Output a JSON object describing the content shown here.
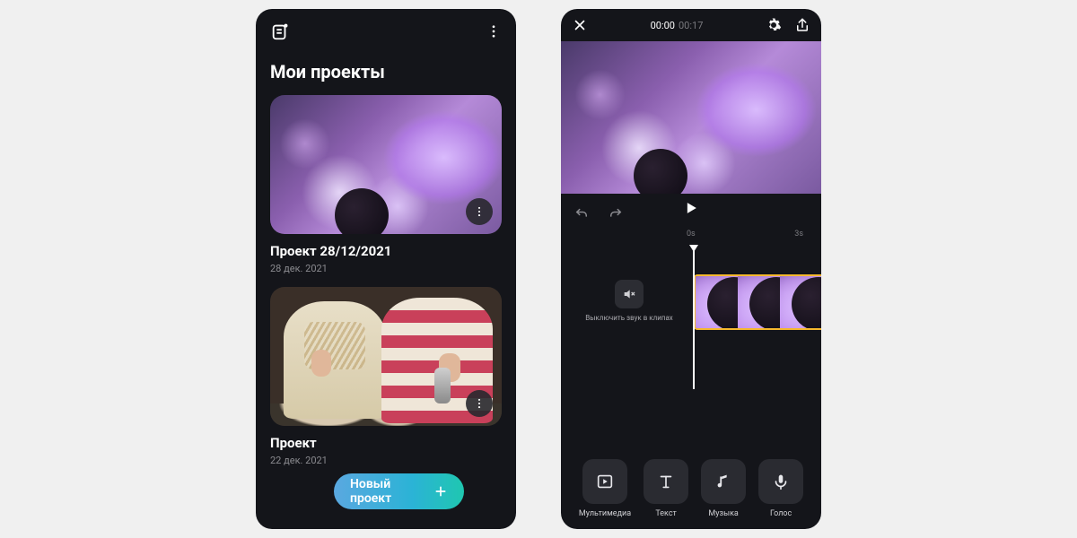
{
  "projects_screen": {
    "title": "Мои проекты",
    "items": [
      {
        "title": "Проект 28/12/2021",
        "date": "28 дек. 2021"
      },
      {
        "title": "Проект",
        "date": "22 дек. 2021"
      }
    ],
    "new_project_label": "Новый проект"
  },
  "editor_screen": {
    "time_current": "00:00",
    "time_total": "00:17",
    "ruler": [
      "0s",
      "3s"
    ],
    "mute_label": "Выключить звук в клипах",
    "tools": [
      {
        "label": "Мультимедиа"
      },
      {
        "label": "Текст"
      },
      {
        "label": "Музыка"
      },
      {
        "label": "Голос"
      }
    ]
  }
}
